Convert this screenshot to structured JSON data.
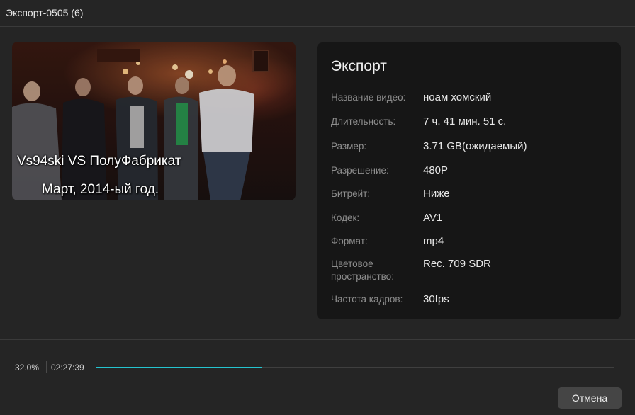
{
  "window": {
    "title": "Экспорт-0505 (6)"
  },
  "preview": {
    "caption_line1": "Vs94ski VS ПолуФабрикат",
    "caption_line2": "Март, 2014-ый год."
  },
  "export_panel": {
    "heading": "Экспорт",
    "rows": [
      {
        "label": "Название видео:",
        "value": "ноам хомский"
      },
      {
        "label": "Длительность:",
        "value": "7 ч. 41 мин. 51 с."
      },
      {
        "label": "Размер:",
        "value": "3.71 GB(ожидаемый)"
      },
      {
        "label": "Разрешение:",
        "value": "480P"
      },
      {
        "label": "Битрейт:",
        "value": "Ниже"
      },
      {
        "label": "Кодек:",
        "value": "AV1"
      },
      {
        "label": "Формат:",
        "value": "mp4"
      },
      {
        "label": "Цветовое пространство:",
        "value": "Rec. 709 SDR"
      },
      {
        "label": "Частота кадров:",
        "value": "30fps"
      }
    ]
  },
  "progress": {
    "percent_text": "32.0%",
    "elapsed": "02:27:39",
    "fraction": 0.32,
    "color": "#25c4cf"
  },
  "footer": {
    "cancel_label": "Отмена"
  }
}
